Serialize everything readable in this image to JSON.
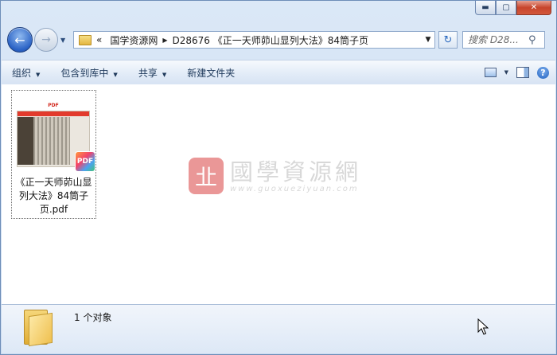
{
  "window": {
    "controls": {
      "minimize_glyph": "▬",
      "maximize_glyph": "▢",
      "close_glyph": "✕"
    }
  },
  "nav": {
    "back_glyph": "←",
    "forward_glyph": "→",
    "history_glyph": "▼"
  },
  "address_bar": {
    "overflow": "«",
    "crumbs": [
      "国学资源网",
      "D28676 《正一天师茆山显列大法》84筒子页"
    ],
    "separator_glyph": "▶",
    "dropdown_glyph": "▼",
    "refresh_glyph": "↻"
  },
  "search": {
    "placeholder": "搜索 D28...",
    "icon": "search-icon"
  },
  "toolbar": {
    "organize": "组织",
    "include_in_library": "包含到库中",
    "share": "共享",
    "new_folder": "新建文件夹",
    "caret": "▼",
    "help": "?"
  },
  "files": [
    {
      "name": "《正一天师茆山显列大法》84筒子页.pdf",
      "thumb_label": "PDF",
      "badge": "PDF",
      "selected": true
    }
  ],
  "watermark": {
    "seal": "㐀",
    "title": "國學資源網",
    "url": "www.guoxueziyuan.com"
  },
  "status": {
    "count": "1 个对象"
  },
  "colors": {
    "accent": "#2a62c5",
    "toolbar_text": "#1e395b",
    "pdf_red": "#e23a2c",
    "watermark_red": "#d94343"
  }
}
